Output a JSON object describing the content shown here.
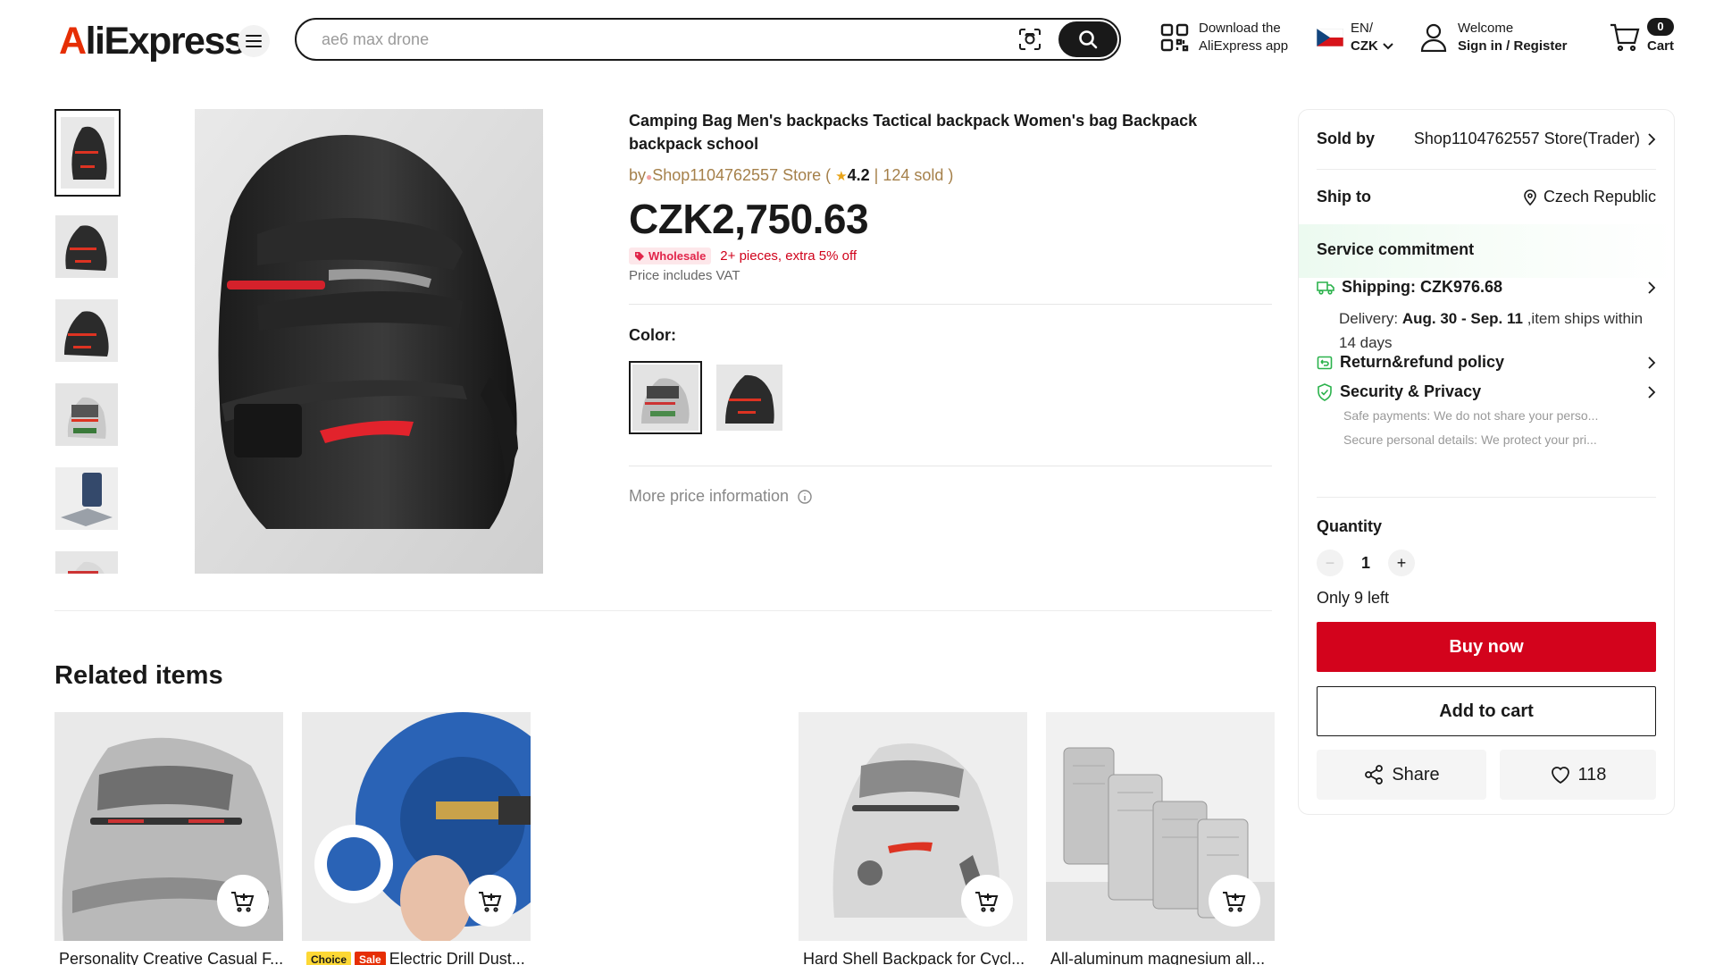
{
  "header": {
    "logo_text": "AliExpress",
    "search_placeholder": "ae6 max drone",
    "app_download_line1": "Download the",
    "app_download_line2": "AliExpress app",
    "lang_line1": "EN/",
    "lang_line2": "CZK",
    "welcome": "Welcome",
    "sign_in": "Sign in / Register",
    "cart_label": "Cart",
    "cart_count": "0"
  },
  "product": {
    "title": "Camping Bag Men's backpacks Tactical backpack Women's bag Backpack backpack school",
    "by_prefix": "by",
    "store": "Shop1104762557 Store",
    "rating": "4.2",
    "sold": "124 sold",
    "price": "CZK2,750.63",
    "wholesale_badge": "Wholesale",
    "wholesale_text": "2+ pieces, extra 5% off",
    "vat_note": "Price includes VAT",
    "color_label": "Color:",
    "more_price_info": "More price information"
  },
  "panel": {
    "sold_by_label": "Sold by",
    "sold_by_value": "Shop1104762557 Store(Trader)",
    "ship_to_label": "Ship to",
    "ship_to_value": "Czech Republic",
    "service_commitment": "Service commitment",
    "shipping_label": "Shipping: CZK976.68",
    "delivery_prefix": "Delivery:",
    "delivery_dates": "Aug. 30 - Sep. 11",
    "delivery_suffix": ",item ships within 14 days",
    "return_policy": "Return&refund policy",
    "security_privacy": "Security & Privacy",
    "security_line1": "Safe payments: We do not share your perso...",
    "security_line2": "Secure personal details: We protect your pri...",
    "quantity_label": "Quantity",
    "quantity_value": "1",
    "stock_note": "Only 9 left",
    "buy_now": "Buy now",
    "add_to_cart": "Add to cart",
    "share": "Share",
    "wishlist_count": "118"
  },
  "related": {
    "title": "Related items",
    "items": [
      {
        "name": "Personality Creative Casual F...",
        "tags": []
      },
      {
        "name": "Electric Drill Dust...",
        "tags": [
          "Choice",
          "Sale"
        ]
      },
      {
        "name": "Hard Shell Backpack for Cycl...",
        "tags": []
      },
      {
        "name": "All-aluminum magnesium all...",
        "tags": []
      }
    ]
  },
  "colors": {
    "brand_red": "#e62e04",
    "buy_red": "#d3031c",
    "store_brown": "#a5804a",
    "service_green": "#2bb24c"
  }
}
